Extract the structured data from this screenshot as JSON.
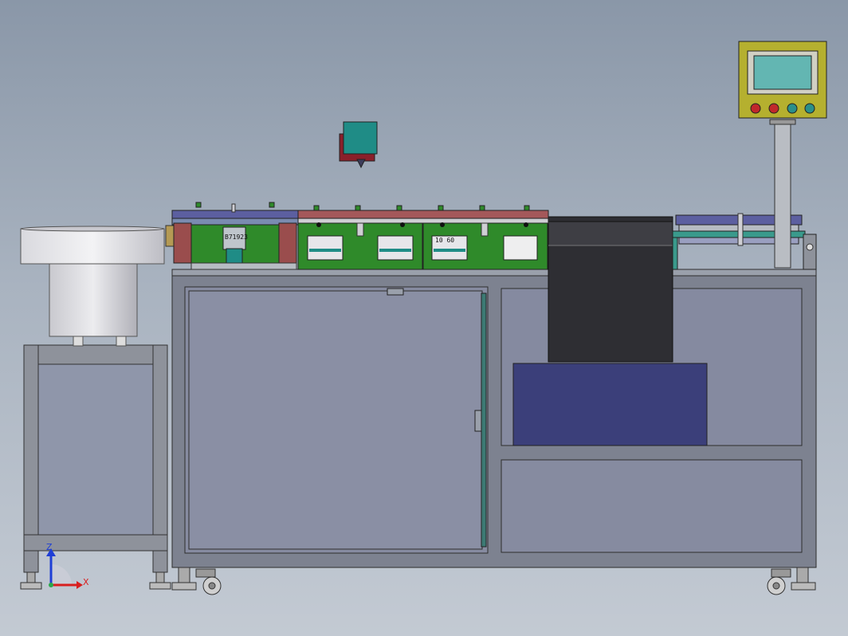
{
  "drawing": {
    "labels": {
      "motor_plate": "B71923",
      "module_left": "B71923",
      "module_right": "10 60"
    },
    "triad": {
      "z": "Z",
      "x": "X",
      "z_color": "#1f3fd6",
      "x_color": "#d81f1f"
    },
    "colors": {
      "frame": "#8b8f9a",
      "panel": "#868ba0",
      "green_module": "#2f8a2a",
      "blue_box": "#3b3f7a",
      "dark_box": "#2e2e33",
      "teal": "#1f8c86",
      "control_panel": "#b5b02f",
      "screen": "#63b6b2"
    },
    "buttons": [
      {
        "name": "red",
        "color": "#c0282b"
      },
      {
        "name": "red",
        "color": "#c0282b"
      },
      {
        "name": "teal",
        "color": "#2a8f8a"
      },
      {
        "name": "teal",
        "color": "#2a8f8a"
      }
    ]
  }
}
